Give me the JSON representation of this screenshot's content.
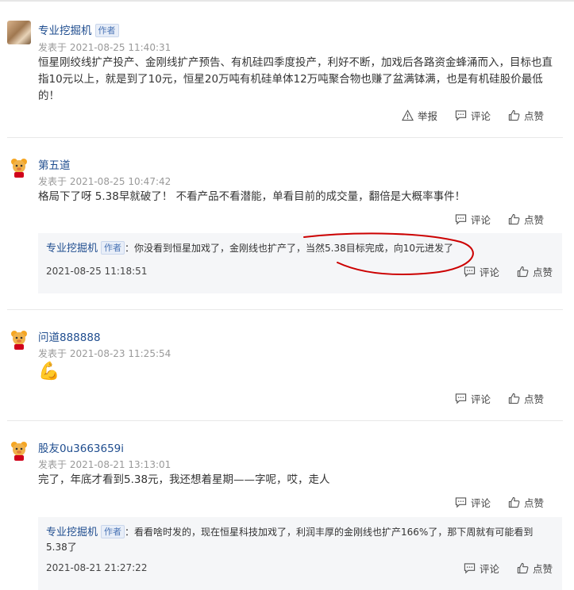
{
  "actions": {
    "report": "举报",
    "comment": "评论",
    "like": "点赞"
  },
  "comments": [
    {
      "username": "专业挖掘机",
      "author_tag": "作者",
      "time": "发表于 2021-08-25 11:40:31",
      "text": "恒星刚绞线扩产投产、金刚线扩产预告、有机硅四季度投产，利好不断，加戏后各路资金蜂涌而入，目标也直指10元以上，就是到了10元，恒星20万吨有机硅单体12万吨聚合物也赚了盆满钵满，也是有机硅股价最低的！"
    },
    {
      "username": "第五道",
      "time": "发表于 2021-08-25 10:47:42",
      "text": "格局下了呀 5.38早就破了！ 不看产品不看潜能，单看目前的成交量，翻倍是大概率事件！",
      "reply": {
        "username": "专业挖掘机",
        "author_tag": "作者",
        "text": "：你没看到恒星加戏了，金刚线也扩产了，当然5.38目标完成，向10元进发了",
        "time": "2021-08-25 11:18:51"
      }
    },
    {
      "username": "问道888888",
      "time": "发表于 2021-08-23 11:25:54",
      "text": "💪"
    },
    {
      "username": "股友0u3663659i",
      "time": "发表于 2021-08-21 13:13:01",
      "text": "完了，年底才看到5.38元，我还想着星期——字呢，哎，走人",
      "reply": {
        "username": "专业挖掘机",
        "author_tag": "作者",
        "text": "：看看啥时发的，现在恒星科技加戏了，利润丰厚的金刚线也扩产166%了，那下周就有可能看到5.38了",
        "time": "2021-08-21 21:27:22"
      }
    }
  ],
  "colors": {
    "link_blue": "#1f4d8f",
    "annotation_red": "#cc0000",
    "reply_bg": "#f5f6f8"
  }
}
